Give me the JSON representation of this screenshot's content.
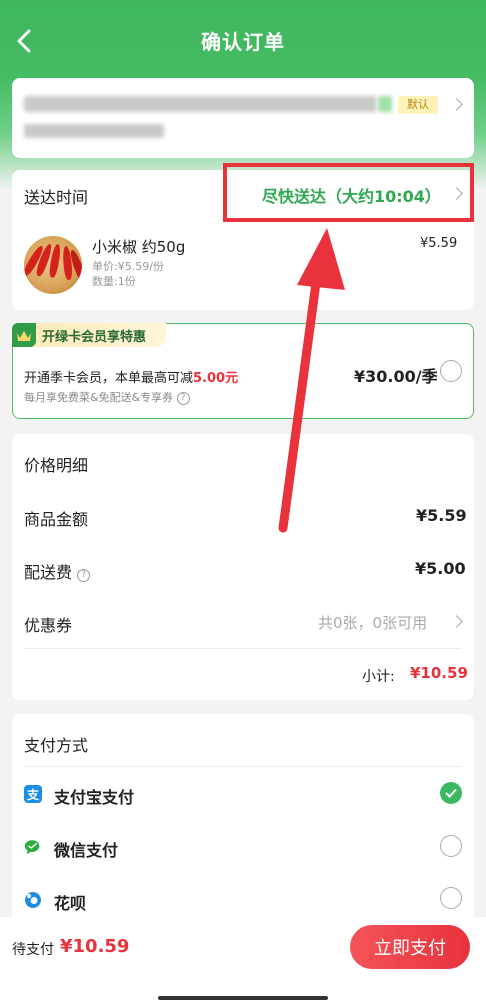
{
  "header": {
    "title": "确认订单"
  },
  "address": {
    "default_badge": "默认"
  },
  "delivery": {
    "label": "送达时间",
    "time": "尽快送达（大约10:04）",
    "product": {
      "name": "小米椒 约50g",
      "unit_price": "单价:¥5.59/份",
      "quantity": "数量:1份",
      "price": "¥5.59"
    }
  },
  "member": {
    "tag": "开绿卡会员享特惠",
    "main_prefix": "开通季卡会员，本单最高可减",
    "main_amount": "5.00元",
    "sub": "每月享免费菜&免配送&专享券",
    "price": "¥30.00/季"
  },
  "price_detail": {
    "title": "价格明细",
    "goods_label": "商品金额",
    "goods_value": "¥5.59",
    "shipping_label": "配送费",
    "shipping_value": "¥5.00",
    "coupon_label": "优惠券",
    "coupon_value": "共0张，0张可用",
    "subtotal_label": "小计:",
    "subtotal_value": "¥10.59"
  },
  "payment": {
    "title": "支付方式",
    "methods": [
      {
        "label": "支付宝支付",
        "icon": "alipay-icon",
        "selected": true
      },
      {
        "label": "微信支付",
        "icon": "wechat-icon",
        "selected": false
      },
      {
        "label": "花呗",
        "icon": "huabei-icon",
        "selected": false
      }
    ]
  },
  "bottom_bar": {
    "to_pay_label": "待支付",
    "to_pay_value": "¥10.59",
    "pay_button": "立即支付"
  },
  "colors": {
    "brand_green": "#3fb75d",
    "accent_red": "#e8323c",
    "delivery_green": "#2fa84f"
  }
}
